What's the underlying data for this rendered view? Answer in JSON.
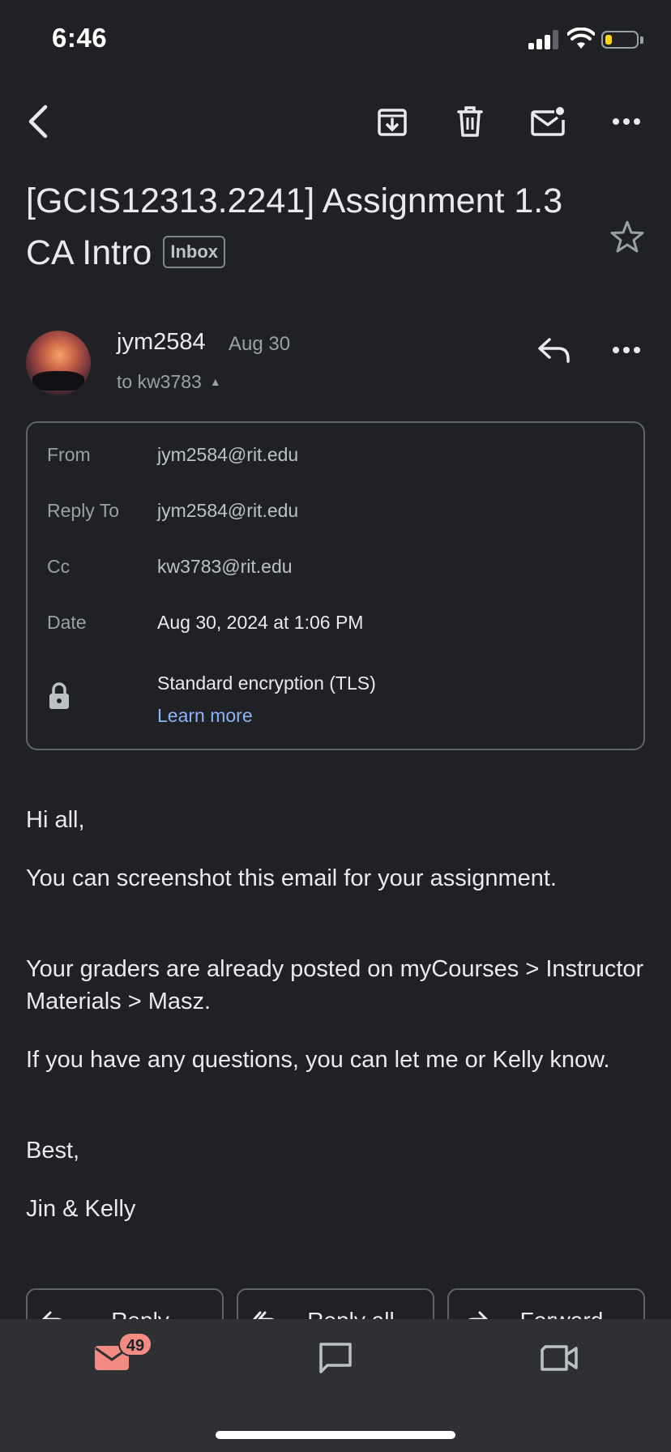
{
  "status_bar": {
    "time": "6:46",
    "battery_level": 0.2,
    "battery_color": "#ffd60a",
    "icons": [
      "cellular-signal-icon",
      "wifi-icon",
      "battery-icon"
    ]
  },
  "toolbar": {
    "icons": [
      "back-arrow-icon",
      "archive-icon",
      "trash-icon",
      "mark-unread-icon",
      "more-horizontal-icon"
    ]
  },
  "email": {
    "subject": "[GCIS12313.2241] Assignment 1.3 CA Intro",
    "label": "Inbox",
    "sender_name": "jym2584",
    "date_short": "Aug 30",
    "recipient_line": "to kw3783",
    "details": {
      "from_label": "From",
      "from_value": "jym2584@rit.edu",
      "reply_to_label": "Reply To",
      "reply_to_value": "jym2584@rit.edu",
      "cc_label": "Cc",
      "cc_value": "kw3783@rit.edu",
      "date_label": "Date",
      "date_value": "Aug 30, 2024 at 1:06 PM",
      "encryption": "Standard encryption (TLS)",
      "learn_more": "Learn more"
    },
    "body": [
      "Hi all,",
      "You can screenshot this email for your assignment.",
      "Your graders are already posted on myCourses > Instructor Materials > Masz.",
      "If you have any questions, you can let me or Kelly know.",
      "Best,",
      "Jin & Kelly"
    ]
  },
  "actions": {
    "reply": "Reply",
    "reply_all": "Reply all",
    "forward": "Forward"
  },
  "bottom_nav": {
    "mail_badge": "49",
    "badge_color": "#f28b82",
    "icons": [
      "mail-icon",
      "chat-icon",
      "video-meet-icon"
    ]
  },
  "colors": {
    "background": "#202124",
    "link": "#8ab4f8",
    "bottom_nav": "#2f3034"
  }
}
